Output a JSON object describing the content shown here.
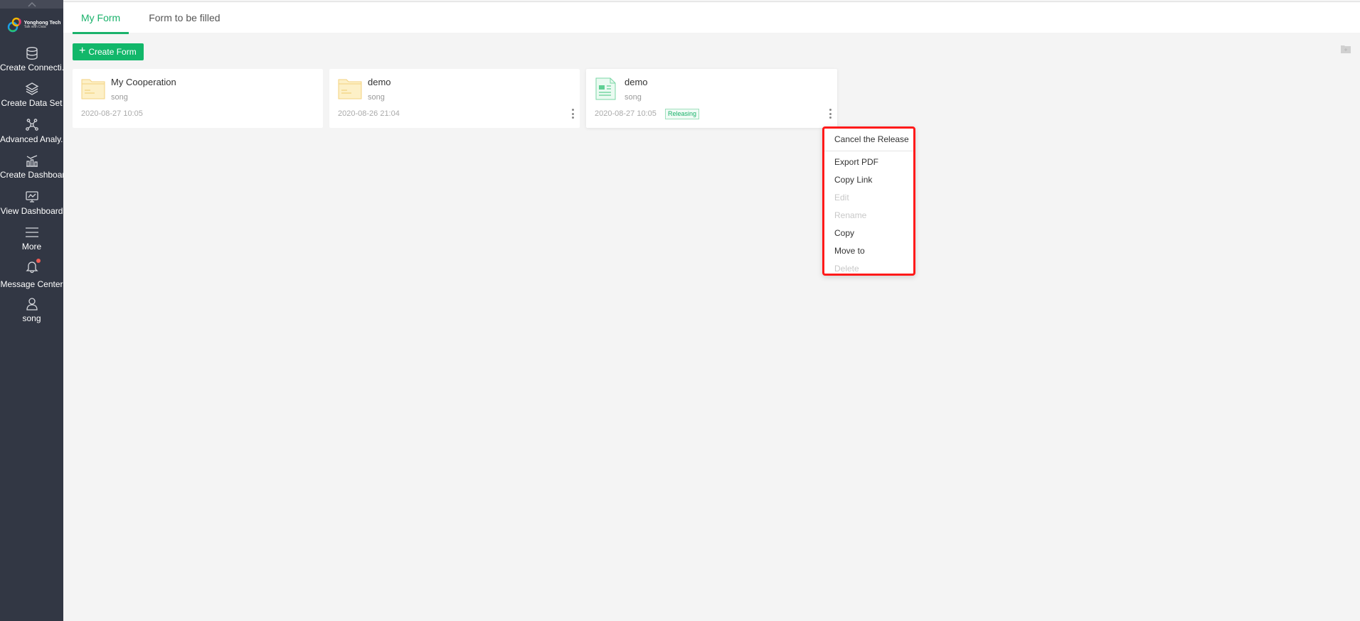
{
  "sidebar": {
    "logo": {
      "name": "Yonghong Tech",
      "tagline": "Talk with Data"
    },
    "items": [
      {
        "label": "Create Connecti...",
        "icon": "database-icon"
      },
      {
        "label": "Create Data Set",
        "icon": "layers-icon"
      },
      {
        "label": "Advanced Analy...",
        "icon": "network-icon"
      },
      {
        "label": "Create Dashboard",
        "icon": "chart-bars-icon"
      },
      {
        "label": "View Dashboard",
        "icon": "monitor-chart-icon"
      },
      {
        "label": "More",
        "icon": "menu-icon"
      },
      {
        "label": "Message Center",
        "icon": "bell-icon",
        "has_notification": true
      },
      {
        "label": "song",
        "icon": "user-icon"
      }
    ]
  },
  "tabs": [
    {
      "label": "My Form",
      "active": true
    },
    {
      "label": "Form to be filled",
      "active": false
    }
  ],
  "toolbar": {
    "create_label": "Create Form"
  },
  "cards": [
    {
      "title": "My Cooperation",
      "owner": "song",
      "date": "2020-08-27 10:05",
      "type": "folder"
    },
    {
      "title": "demo",
      "owner": "song",
      "date": "2020-08-26 21:04",
      "type": "folder"
    },
    {
      "title": "demo",
      "owner": "song",
      "date": "2020-08-27 10:05",
      "type": "form",
      "status": "Releasing"
    }
  ],
  "context_menu": {
    "items": [
      {
        "label": "Cancel the Release",
        "disabled": false
      },
      {
        "label": "Export PDF",
        "disabled": false
      },
      {
        "label": "Copy Link",
        "disabled": false
      },
      {
        "label": "Edit",
        "disabled": true
      },
      {
        "label": "Rename",
        "disabled": true
      },
      {
        "label": "Copy",
        "disabled": false
      },
      {
        "label": "Move to",
        "disabled": false
      },
      {
        "label": "Delete",
        "disabled": true
      }
    ]
  },
  "colors": {
    "accent": "#1ab26b",
    "sidebar_bg": "#323744",
    "highlight_border": "#ff1a1a",
    "folder": "#fce9b4"
  }
}
